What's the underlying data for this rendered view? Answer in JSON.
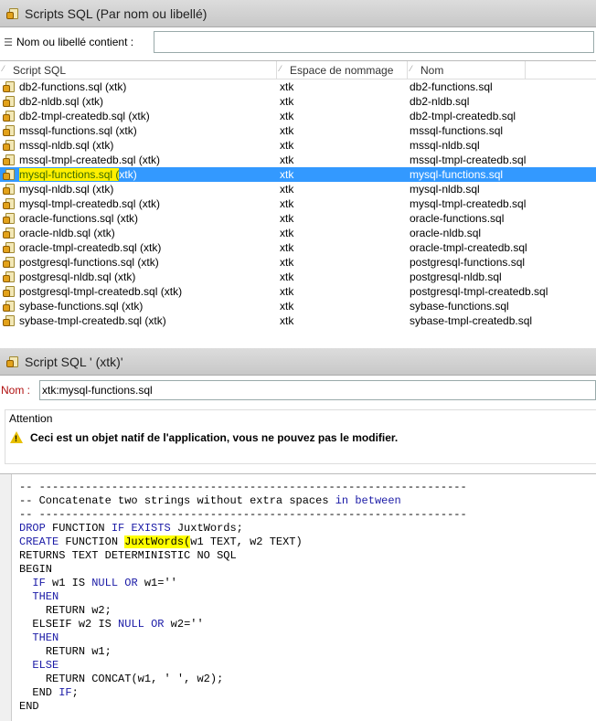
{
  "list_window": {
    "title": "Scripts SQL (Par nom ou libellé)",
    "filter_label": "Nom ou libellé contient :",
    "filter_value": "",
    "columns": [
      "Script SQL",
      "Espace de nommage",
      "Nom"
    ],
    "rows": [
      {
        "script": "db2-functions.sql (xtk)",
        "ns": "xtk",
        "name": "db2-functions.sql"
      },
      {
        "script": "db2-nldb.sql (xtk)",
        "ns": "xtk",
        "name": "db2-nldb.sql"
      },
      {
        "script": "db2-tmpl-createdb.sql (xtk)",
        "ns": "xtk",
        "name": "db2-tmpl-createdb.sql"
      },
      {
        "script": "mssql-functions.sql (xtk)",
        "ns": "xtk",
        "name": "mssql-functions.sql"
      },
      {
        "script": "mssql-nldb.sql (xtk)",
        "ns": "xtk",
        "name": "mssql-nldb.sql"
      },
      {
        "script": "mssql-tmpl-createdb.sql (xtk)",
        "ns": "xtk",
        "name": "mssql-tmpl-createdb.sql"
      },
      {
        "script": "mysql-functions.sql (xtk)",
        "ns": "xtk",
        "name": "mysql-functions.sql",
        "selected": true
      },
      {
        "script": "mysql-nldb.sql (xtk)",
        "ns": "xtk",
        "name": "mysql-nldb.sql"
      },
      {
        "script": "mysql-tmpl-createdb.sql (xtk)",
        "ns": "xtk",
        "name": "mysql-tmpl-createdb.sql"
      },
      {
        "script": "oracle-functions.sql (xtk)",
        "ns": "xtk",
        "name": "oracle-functions.sql"
      },
      {
        "script": "oracle-nldb.sql (xtk)",
        "ns": "xtk",
        "name": "oracle-nldb.sql"
      },
      {
        "script": "oracle-tmpl-createdb.sql (xtk)",
        "ns": "xtk",
        "name": "oracle-tmpl-createdb.sql"
      },
      {
        "script": "postgresql-functions.sql (xtk)",
        "ns": "xtk",
        "name": "postgresql-functions.sql"
      },
      {
        "script": "postgresql-nldb.sql (xtk)",
        "ns": "xtk",
        "name": "postgresql-nldb.sql"
      },
      {
        "script": "postgresql-tmpl-createdb.sql (xtk)",
        "ns": "xtk",
        "name": "postgresql-tmpl-createdb.sql"
      },
      {
        "script": "sybase-functions.sql (xtk)",
        "ns": "xtk",
        "name": "sybase-functions.sql"
      },
      {
        "script": "sybase-tmpl-createdb.sql (xtk)",
        "ns": "xtk",
        "name": "sybase-tmpl-createdb.sql"
      }
    ],
    "selection_color": "#3399ff"
  },
  "detail_window": {
    "title": "Script SQL ' (xtk)'",
    "name_label": "Nom :",
    "name_value": "xtk:mysql-functions.sql",
    "attention_title": "Attention",
    "attention_message": "Ceci est un objet natif de l'application, vous ne pouvez pas le modifier.",
    "code_lines": [
      "-- -----------------------------------------------------------------",
      "-- Concatenate two strings without extra spaces in between",
      "-- -----------------------------------------------------------------",
      "DROP FUNCTION IF EXISTS JuxtWords;",
      "CREATE FUNCTION JuxtWords(w1 TEXT, w2 TEXT)",
      "RETURNS TEXT DETERMINISTIC NO SQL",
      "BEGIN",
      "  IF w1 IS NULL OR w1=''",
      "  THEN",
      "    RETURN w2;",
      "  ELSEIF w2 IS NULL OR w2=''",
      "  THEN",
      "    RETURN w1;",
      "  ELSE",
      "    RETURN CONCAT(w1, ' ', w2);",
      "  END IF;",
      "END"
    ]
  },
  "icons": {
    "title_icon": "sql-script-icon",
    "row_icon": "sql-script-icon",
    "filter_icon": "filter-icon",
    "warning_icon": "warning-icon"
  }
}
